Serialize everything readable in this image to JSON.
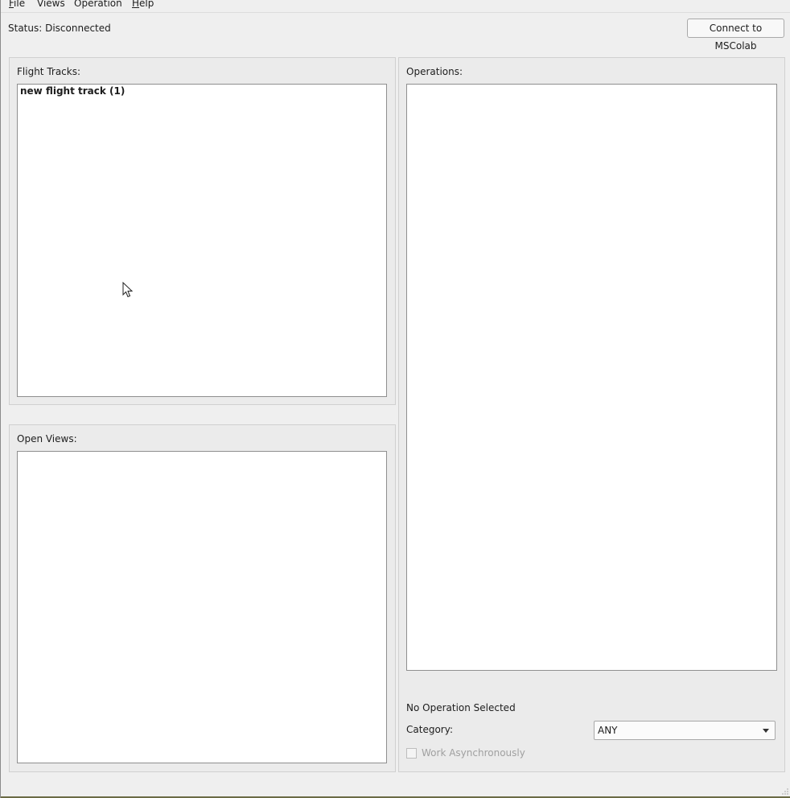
{
  "menubar": {
    "items": [
      {
        "label": "File",
        "mnemonic": "F",
        "rest": "ile"
      },
      {
        "label": "Views",
        "mnemonic": "",
        "rest": "Views"
      },
      {
        "label": "Operation",
        "mnemonic": "",
        "rest": "Operation"
      },
      {
        "label": "Help",
        "mnemonic": "H",
        "rest": "elp"
      }
    ]
  },
  "status": {
    "text": "Status: Disconnected"
  },
  "connect_button": {
    "label": "Connect to MSColab"
  },
  "flight_tracks": {
    "label": "Flight Tracks:",
    "items": [
      "new flight track (1)"
    ]
  },
  "open_views": {
    "label": "Open Views:",
    "items": []
  },
  "operations": {
    "label": "Operations:",
    "items": [],
    "selected_text": "No Operation Selected",
    "category_label": "Category:",
    "category_value": "ANY",
    "async_label": "Work Asynchronously"
  },
  "icons": {
    "cursor": "mouse-pointer-icon",
    "combo_arrow": "chevron-down-icon",
    "grip": "resize-grip-icon"
  },
  "colors": {
    "window_bg": "#efefef",
    "list_bg": "#ffffff",
    "disabled_text": "#a0a0a0"
  }
}
